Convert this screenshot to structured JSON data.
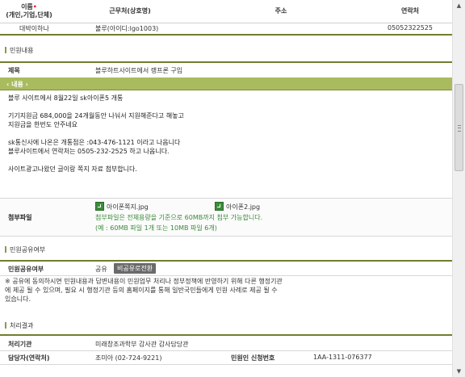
{
  "top_table": {
    "headers": {
      "name": "이름",
      "name_sub": "(개인,기업,단체)",
      "required_mark": "•",
      "workplace": "근무처(상호명)",
      "address": "주소",
      "contact": "연락처"
    },
    "row": {
      "name": "대박이하나",
      "workplace": "불루(아이디:lgo1003)",
      "address": "",
      "contact": "05052322525"
    }
  },
  "section_complaint": "민원내용",
  "subject_label": "제목",
  "subject_value": "블루하트사이트에서 랭프론 구입",
  "content_bar": "‹ 내용 ›",
  "content_lines": [
    "블루 사이트에서 8월22일 sk아이폰5 개통",
    "",
    "기기지원금 684,000을 24개월동안 나눠서 지원해준다고 해놓고",
    "지원금을 한번도 안주네요",
    "",
    "sk통신사에 나온은 개통점은 :043-476-1121 이라고 나옵니다",
    "블루사이트에서 연락처는 0505-232-2525 하고 나옵니다.",
    "",
    "사이트광고나왔던 글이랑 쪽지 자료 첨부합니다."
  ],
  "attach": {
    "label": "첨부파일",
    "files": [
      "아이폰쪽지.jpg",
      "아이폰2.jpg"
    ],
    "note1": "첨부파일은 전체용량을 기준으로 60MB까지 첨부 가능합니다.",
    "note2": "(예 : 60MB 파일 1개 또는 10MB 파일 6개)"
  },
  "section_share": "민원공유여부",
  "share_label": "민원공유여부",
  "share_value": "공유",
  "share_button": "비공유로전환",
  "notice_lines": [
    "※ 공유에 동의하시면 민원내용과 답변내용이 민원업무 처리나 정부정책에 반영하기 위해 다른 행정기관",
    "    에 제공 될 수 있으며, 필요 시 행정기관 등의 홈페이지를 통해 일반국민들에게 민원 사례로 제공 될 수",
    "    있습니다."
  ],
  "section_result": "처리결과",
  "result": {
    "agency_label": "처리기관",
    "agency_value": "미래창조과학부 감사관 감사담당관",
    "manager_label": "담당자(연락처)",
    "manager_value": "조미아 (02-724-9221)",
    "reqno_label": "민원인 신청번호",
    "reqno_value": "1AA-1311-076377"
  },
  "scrollbar": {
    "up": "▲",
    "down": "▼"
  }
}
